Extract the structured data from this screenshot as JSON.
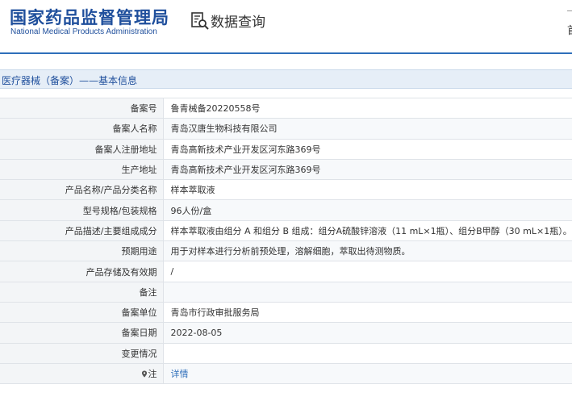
{
  "header": {
    "logo_cn": "国家药品监督管理局",
    "logo_en": "National Medical Products Administration",
    "query_title": "数据查询",
    "corner_glyph": "首"
  },
  "section": {
    "title": "医疗器械（备案）——基本信息"
  },
  "rows": [
    {
      "label": "备案号",
      "value": "鲁青械备20220558号"
    },
    {
      "label": "备案人名称",
      "value": "青岛汉唐生物科技有限公司"
    },
    {
      "label": "备案人注册地址",
      "value": "青岛高新技术产业开发区河东路369号"
    },
    {
      "label": "生产地址",
      "value": "青岛高新技术产业开发区河东路369号"
    },
    {
      "label": "产品名称/产品分类名称",
      "value": "样本萃取液"
    },
    {
      "label": "型号规格/包装规格",
      "value": "96人份/盒"
    },
    {
      "label": "产品描述/主要组成成分",
      "value": "样本萃取液由组分 A 和组分 B 组成：组分A硫酸锌溶液（11 mL×1瓶）、组分B甲醇（30 mL×1瓶）。"
    },
    {
      "label": "预期用途",
      "value": "用于对样本进行分析前预处理，溶解细胞，萃取出待测物质。"
    },
    {
      "label": "产品存储及有效期",
      "value": "/"
    },
    {
      "label": "备注",
      "value": ""
    },
    {
      "label": "备案单位",
      "value": "青岛市行政审批服务局"
    },
    {
      "label": "备案日期",
      "value": "2022-08-05"
    },
    {
      "label": "变更情况",
      "value": ""
    },
    {
      "label": "注",
      "value": "详情"
    }
  ]
}
